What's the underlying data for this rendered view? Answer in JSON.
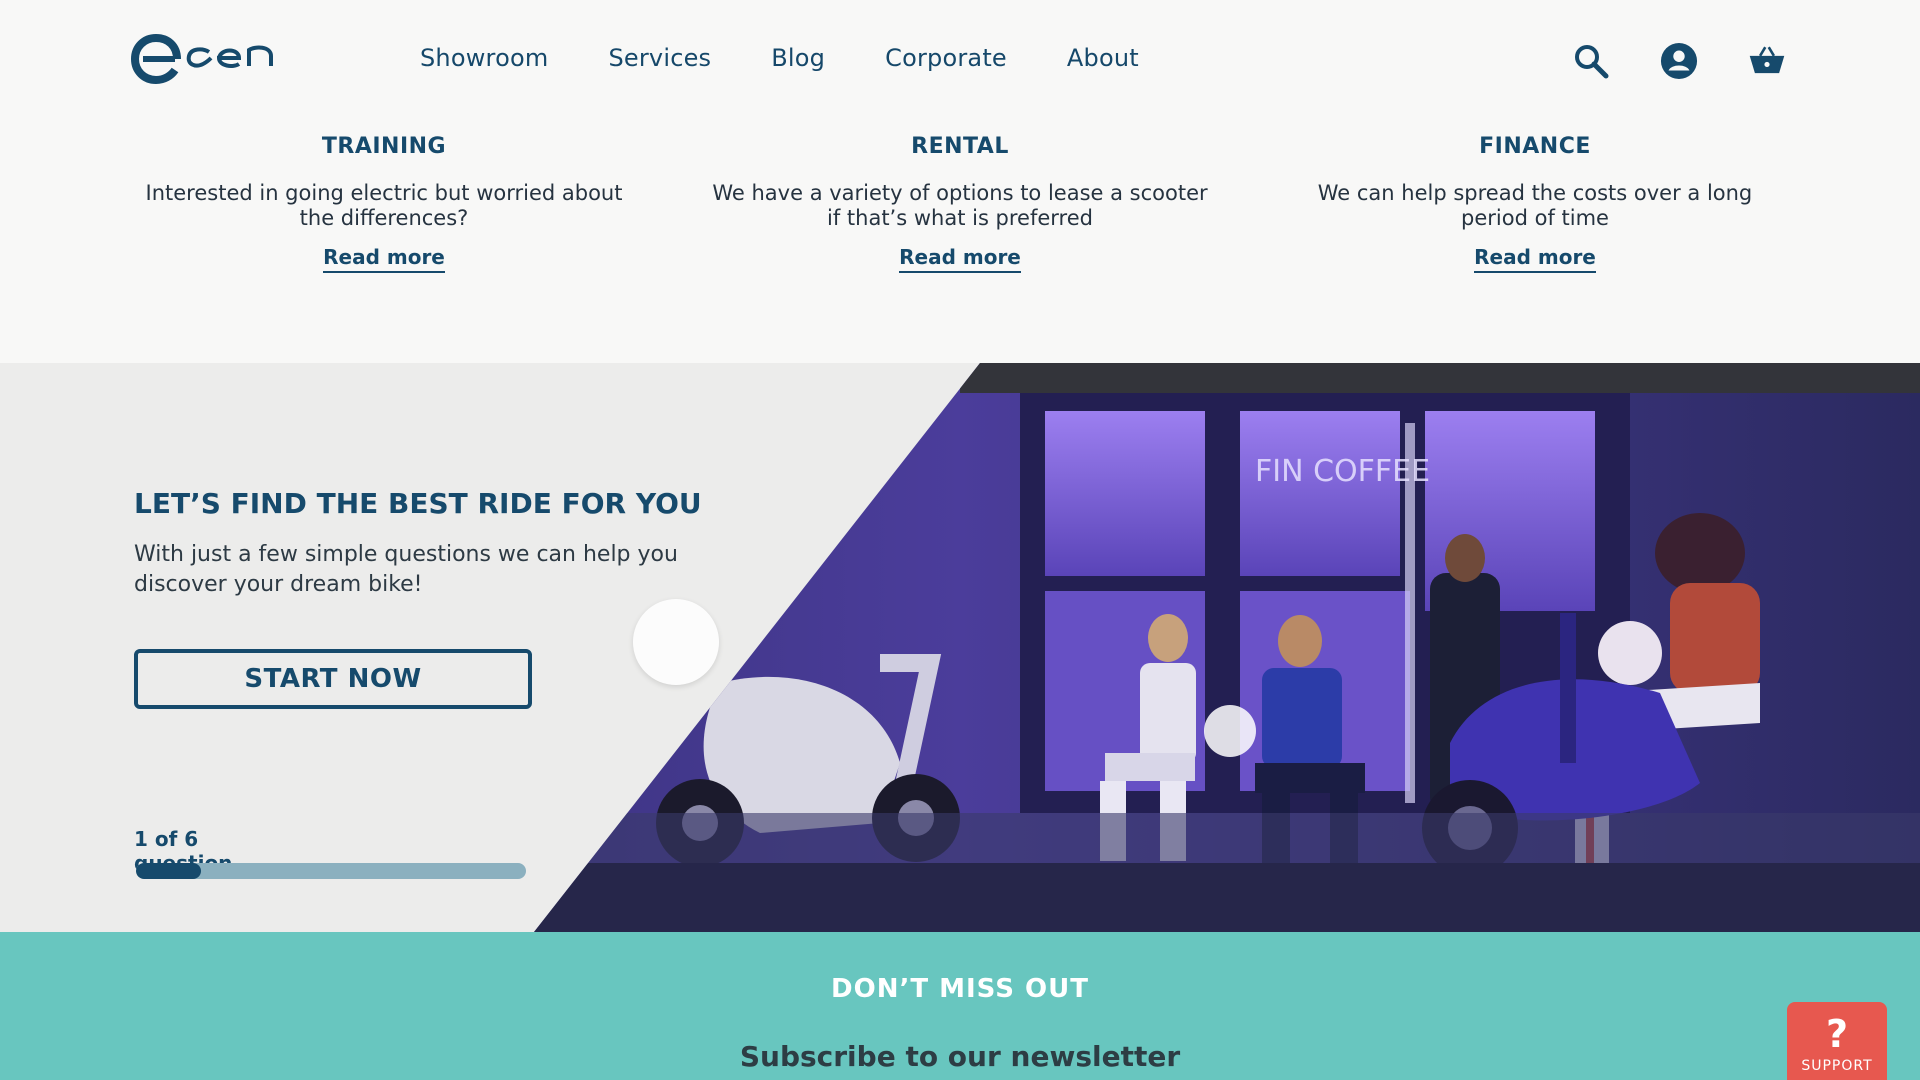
{
  "brand": {
    "logo_text": "egen"
  },
  "nav": {
    "items": [
      "Showroom",
      "Services",
      "Blog",
      "Corporate",
      "About"
    ]
  },
  "header_icons": [
    "search-icon",
    "account-icon",
    "basket-icon"
  ],
  "services": [
    {
      "title": "TRAINING",
      "text": "Interested in going electric but worried about the differences?",
      "link": "Read more"
    },
    {
      "title": "RENTAL",
      "text": "We have a variety of options to lease a scooter if that’s what is preferred",
      "link": "Read more"
    },
    {
      "title": "FINANCE",
      "text": "We can help spread the costs over a long period of time",
      "link": "Read more"
    }
  ],
  "hero": {
    "title": "LET’S FIND THE BEST RIDE FOR YOU",
    "subtitle": "With just a few simple questions we can help you discover your dream bike!",
    "button": "START NOW",
    "progress_label": "1 of 6 question",
    "progress_fraction": 0.1667
  },
  "photo_sign": "FIN COFFEE",
  "newsletter": {
    "title": "DON’T MISS OUT",
    "subtitle": "Subscribe to our newsletter"
  },
  "support": {
    "symbol": "?",
    "label": "SUPPORT"
  },
  "colors": {
    "primary": "#164a6c",
    "teal": "#68c6bf",
    "support": "#e7584f"
  }
}
